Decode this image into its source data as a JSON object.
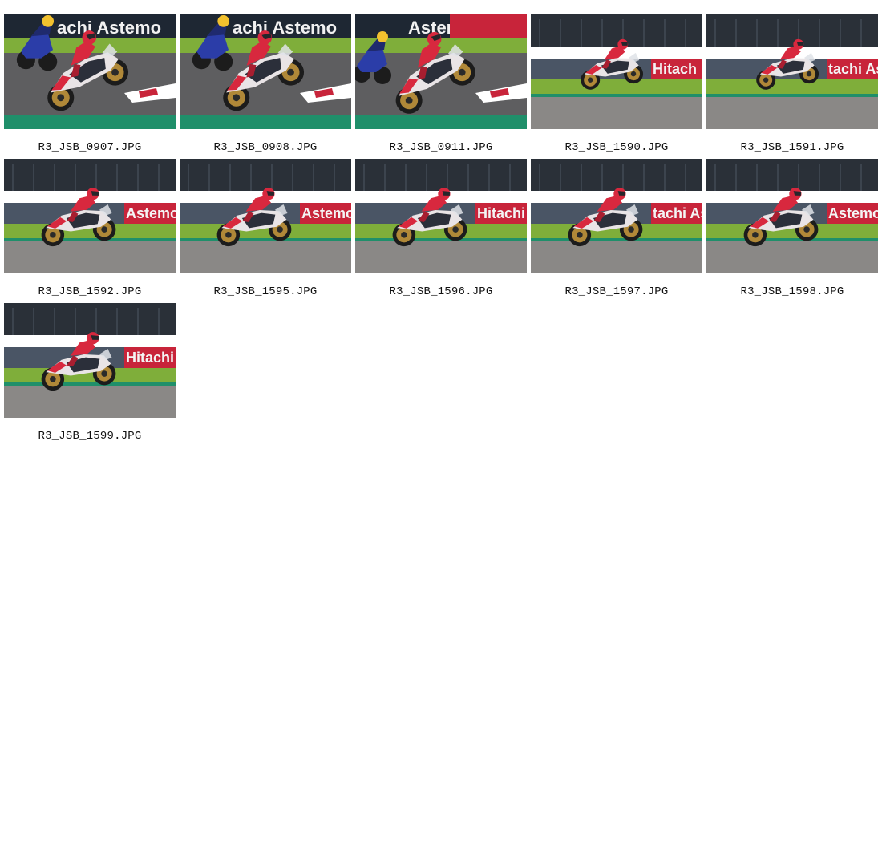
{
  "gallery": {
    "items": [
      {
        "filename": "R3_JSB_0907.JPG",
        "scene": "corner-pack",
        "banner": "achi Astemo"
      },
      {
        "filename": "R3_JSB_0908.JPG",
        "scene": "corner-pack",
        "banner": "achi Astemo"
      },
      {
        "filename": "R3_JSB_0911.JPG",
        "scene": "corner-chase",
        "banner": "Astemo  Hitach"
      },
      {
        "filename": "R3_JSB_1590.JPG",
        "scene": "straight",
        "banner": "Hitach"
      },
      {
        "filename": "R3_JSB_1591.JPG",
        "scene": "straight",
        "banner": "tachi Ast"
      },
      {
        "filename": "R3_JSB_1592.JPG",
        "scene": "straight-near",
        "banner": "Astemo"
      },
      {
        "filename": "R3_JSB_1595.JPG",
        "scene": "straight-near",
        "banner": "Astemo"
      },
      {
        "filename": "R3_JSB_1596.JPG",
        "scene": "straight-near",
        "banner": "Hitachi"
      },
      {
        "filename": "R3_JSB_1597.JPG",
        "scene": "straight-near",
        "banner": "tachi Aste"
      },
      {
        "filename": "R3_JSB_1598.JPG",
        "scene": "straight-near",
        "banner": "Astemo"
      },
      {
        "filename": "R3_JSB_1599.JPG",
        "scene": "straight-near",
        "banner": "Hitachi"
      }
    ]
  },
  "colors": {
    "track": "#5e5e60",
    "kerb_green": "#1f8f6a",
    "grass": "#7fae3a",
    "banner_red": "#c8243a",
    "banner_grey": "#4a5565",
    "bike_white": "#e9e4e6",
    "bike_red": "#d8283e",
    "wheel_gold": "#b08838",
    "caption_text": "#111111"
  }
}
